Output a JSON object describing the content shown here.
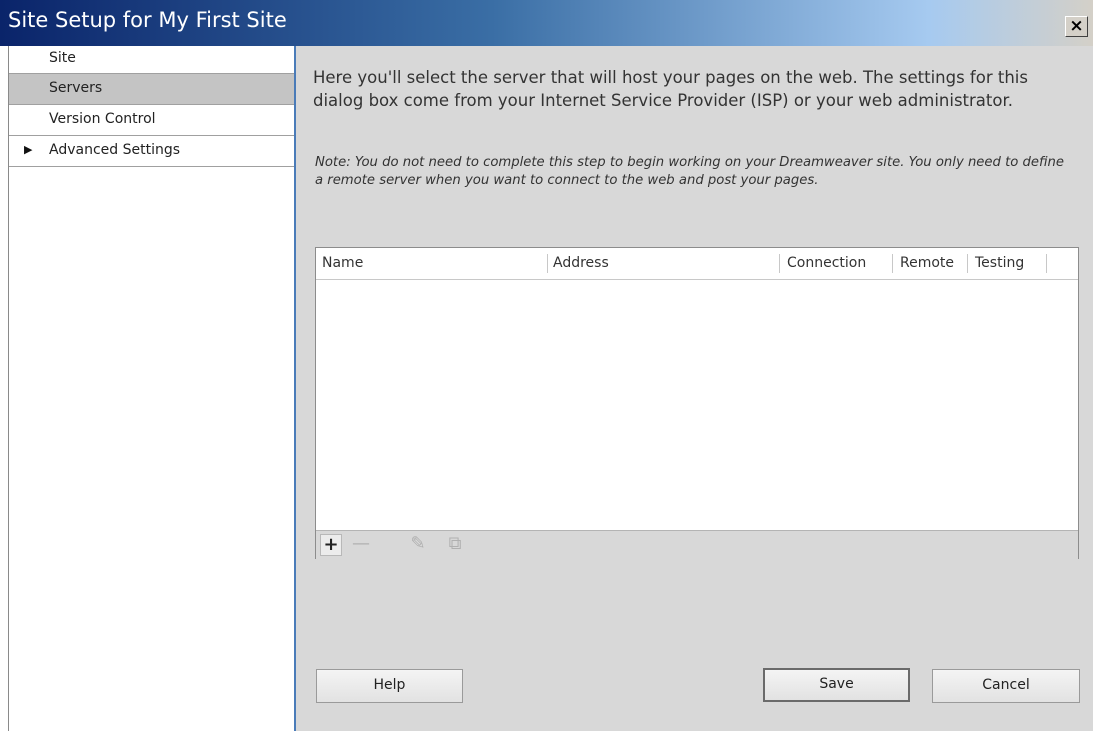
{
  "window": {
    "title": "Site Setup for My First Site",
    "close_label": "×"
  },
  "sidebar": {
    "items": [
      {
        "label": "Site",
        "selected": false
      },
      {
        "label": "Servers",
        "selected": true
      },
      {
        "label": "Version Control",
        "selected": false
      },
      {
        "label": "Advanced Settings",
        "selected": false,
        "expand_icon": "triangle-right-icon",
        "expand_glyph": "▶"
      }
    ]
  },
  "main": {
    "intro": "Here you'll select the server that will host your pages on the web. The settings for this dialog box come from your Internet Service Provider (ISP) or your web administrator.",
    "note": "Note: You do not need to complete this step to begin working on your Dreamweaver site. You only need to define a remote server when you want to connect to the web and post your pages.",
    "servers_table": {
      "columns": [
        "Name",
        "Address",
        "Connection",
        "Remote",
        "Testing"
      ],
      "rows": []
    },
    "toolbar": {
      "add": {
        "icon": "plus-icon",
        "glyph": "+",
        "enabled": true
      },
      "remove": {
        "icon": "minus-icon",
        "glyph": "—",
        "enabled": false
      },
      "edit": {
        "icon": "pencil-icon",
        "glyph": "✎",
        "enabled": false
      },
      "duplicate": {
        "icon": "duplicate-icon",
        "glyph": "⧉",
        "enabled": false
      }
    }
  },
  "footer": {
    "help_label": "Help",
    "save_label": "Save",
    "cancel_label": "Cancel"
  },
  "colors": {
    "title_bar_start": "#0a246a",
    "title_bar_end": "#d4d0c8",
    "selected_item": "#c4c4c4",
    "panel_background": "#d8d8d8",
    "divider_accent": "#4a7bb8"
  }
}
